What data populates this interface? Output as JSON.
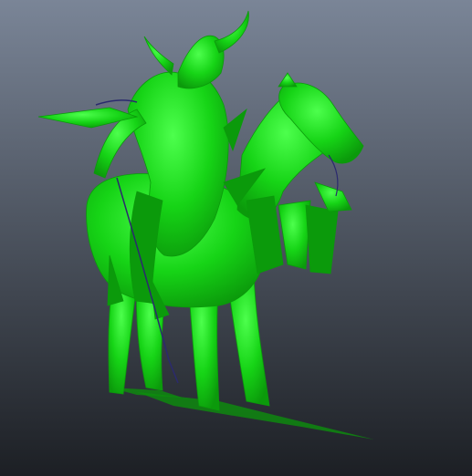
{
  "viewport": {
    "background_top": "#7a8597",
    "background_bottom": "#1c1f24",
    "model_color": "#16d416",
    "model_shade": "#0b9a0b",
    "model_highlight": "#4dff4d",
    "rein_color": "#2b2a6e",
    "shadow_color": "#0d8f0d"
  },
  "model": {
    "description_icon": "horse-rider-3d-model"
  }
}
